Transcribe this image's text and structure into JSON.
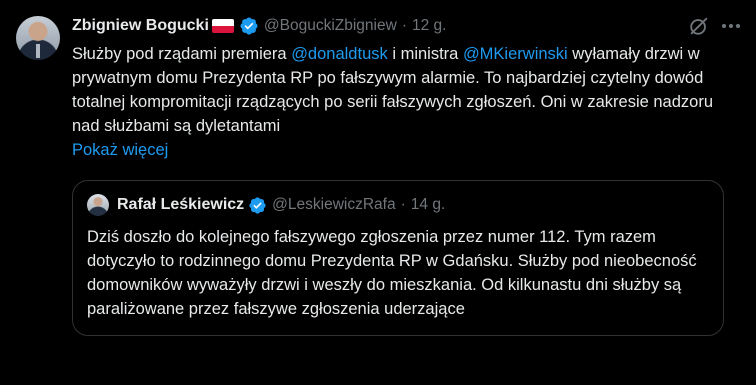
{
  "author": {
    "name": "Zbigniew Bogucki",
    "handle": "@BoguckiZbigniew",
    "separator": "·",
    "time": "12 g."
  },
  "tweet": {
    "text_before_mention1": "Służby pod rządami premiera ",
    "mention1": "@donaldtusk",
    "text_between_mentions": " i ministra ",
    "mention2": "@MKierwinski",
    "text_after_mentions": " wyłamały drzwi w prywatnym domu Prezydenta RP po fałszywym alarmie. To najbardziej czytelny dowód totalnej kompromitacji rządzących po serii fałszywych zgłoszeń. Oni w zakresie nadzoru nad służbami są dyletantami",
    "show_more": "Pokaż więcej"
  },
  "quote": {
    "name": "Rafał Leśkiewicz",
    "handle": "@LeskiewiczRafa",
    "separator": "·",
    "time": "14 g.",
    "text": "Dziś doszło do kolejnego fałszywego zgłoszenia przez numer 112. Tym razem dotyczyło to rodzinnego domu Prezydenta RP w Gdańsku. Służby pod nieobecność  domowników wyważyły drzwi i weszły do mieszkania. Od kilkunastu dni służby są paraliżowane przez fałszywe zgłoszenia uderzające"
  },
  "icons": {
    "verified": "verified-badge-icon",
    "flag": "poland-flag-icon",
    "grok": "grok-icon",
    "more": "more-icon"
  },
  "colors": {
    "background": "#000000",
    "text": "#e7e9ea",
    "secondary": "#71767b",
    "accent": "#1d9bf0",
    "border": "#2f3336",
    "flag_white": "#ffffff",
    "flag_red": "#dc143c"
  }
}
